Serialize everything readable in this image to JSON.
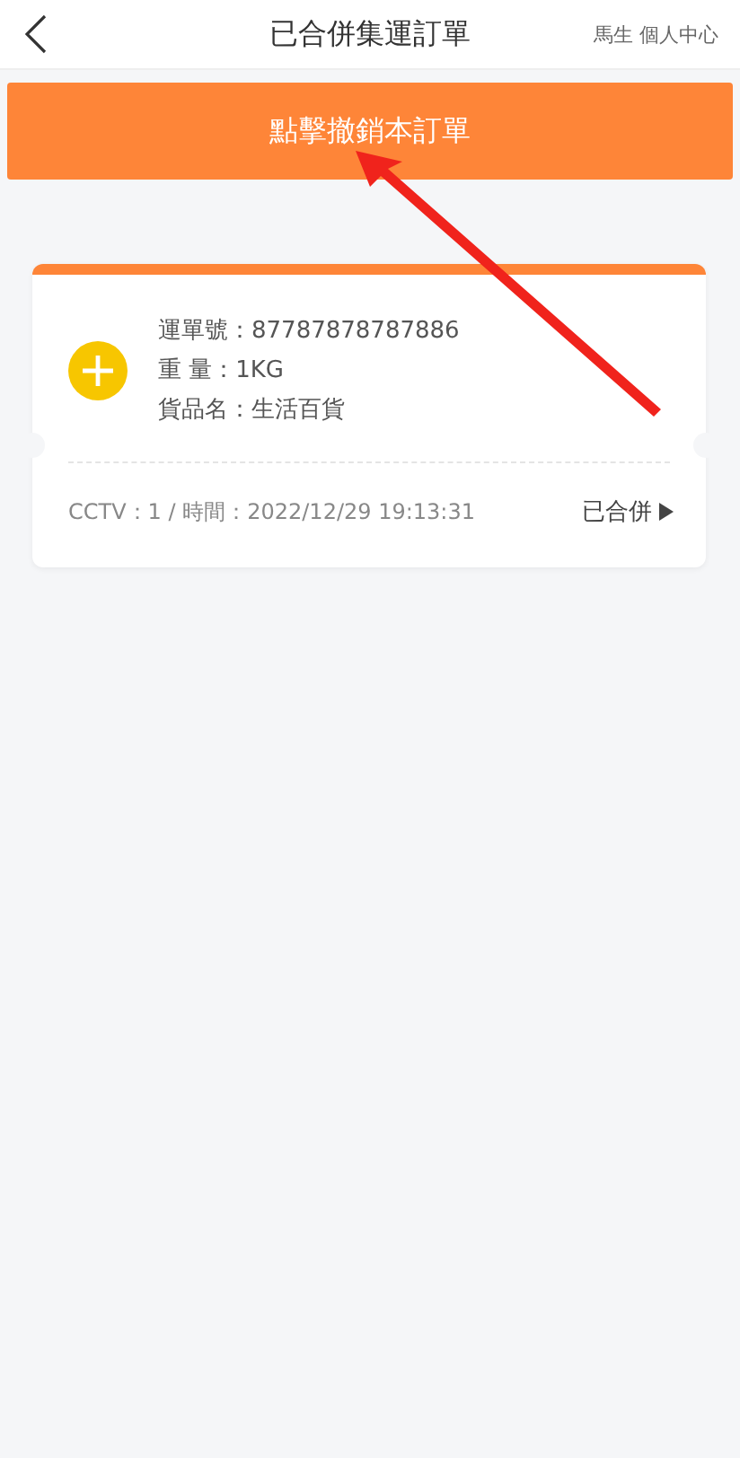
{
  "header": {
    "title": "已合併集運訂單",
    "user_link": "馬生 個人中心"
  },
  "action_button": {
    "label": "點擊撤銷本訂單"
  },
  "orders": [
    {
      "lines": [
        "運單號：87787878787886",
        "重 量：1KG",
        "貨品名：生活百貨"
      ],
      "footer": "CCTV：1 / 時間：2022/12/29 19:13:31",
      "status": "已合併"
    }
  ]
}
